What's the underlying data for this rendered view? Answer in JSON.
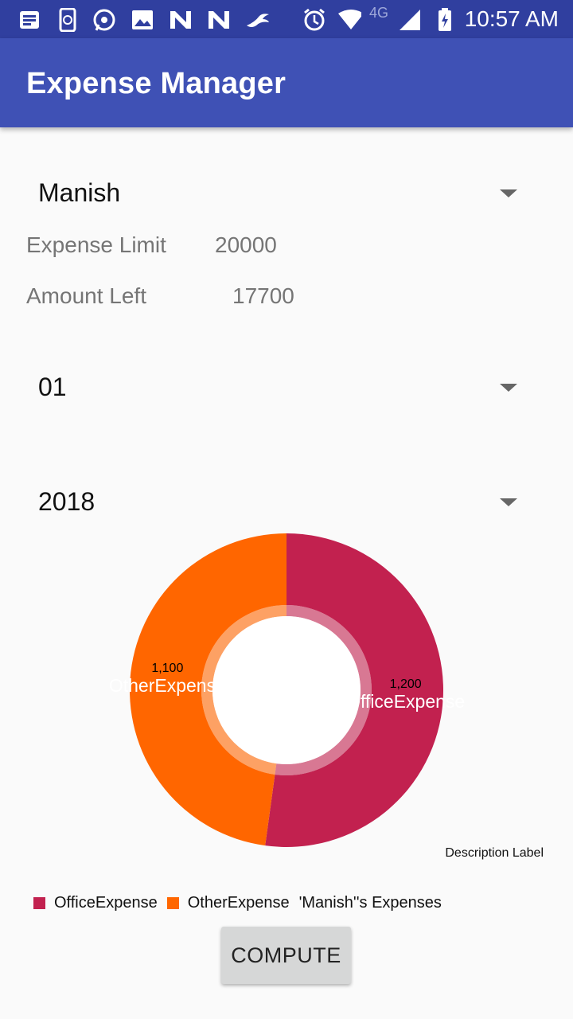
{
  "status_bar": {
    "time": "10:57 AM",
    "network": "4G",
    "icons": [
      "notes-icon",
      "phone-sync-icon",
      "whatsapp-icon",
      "gallery-icon",
      "n-app-icon",
      "n-app-icon",
      "bird-app-icon",
      "alarm-icon",
      "wifi-icon",
      "signal-icon",
      "battery-charging-icon"
    ]
  },
  "app_bar": {
    "title": "Expense Manager"
  },
  "user_spinner": {
    "selected": "Manish"
  },
  "expense_limit": {
    "label": "Expense Limit",
    "value": "20000"
  },
  "amount_left": {
    "label": "Amount Left",
    "value": "17700"
  },
  "month_spinner": {
    "selected": "01"
  },
  "year_spinner": {
    "selected": "2018"
  },
  "colors": {
    "office": "#c2214f",
    "other": "#ff6600",
    "primary": "#3f51b5",
    "primary_dark": "#303f9f"
  },
  "chart_data": {
    "type": "pie",
    "categories": [
      "OfficeExpense",
      "OtherExpense"
    ],
    "values": [
      1200,
      1100
    ],
    "value_labels": [
      "1,200",
      "1,100"
    ],
    "colors": [
      "#c2214f",
      "#ff6600"
    ],
    "hole": true,
    "description": "Description Label",
    "legend": {
      "entries": [
        "OfficeExpense",
        "OtherExpense"
      ],
      "description": "'Manish''s Expenses",
      "position": "bottom-left"
    }
  },
  "compute_button": {
    "label": "COMPUTE"
  }
}
